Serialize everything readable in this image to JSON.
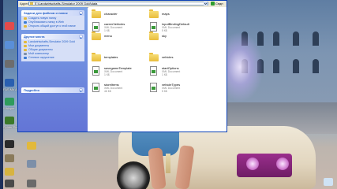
{
  "window": {
    "address_label": "Адрес",
    "address_value": "E:\\Landwirtschafts-Simulator 2009 Gold\\data",
    "go_label": "Седп"
  },
  "taskpane": {
    "panels": [
      {
        "title": "Задачи для файлов и папок",
        "expanded": true,
        "items": [
          {
            "label": "Создать новую папку",
            "icon": "new-folder-icon",
            "color": "#e2b93b"
          },
          {
            "label": "Опубликовать папку в Web",
            "icon": "publish-web-icon",
            "color": "#3a7bd5"
          },
          {
            "label": "Открыть общий доступ к этой папке",
            "icon": "share-folder-icon",
            "color": "#e2b93b"
          }
        ]
      },
      {
        "title": "Другие места",
        "expanded": true,
        "items": [
          {
            "label": "Landwirtschafts-Simulator 2009 Gold",
            "icon": "folder-icon",
            "color": "#e2b93b"
          },
          {
            "label": "Мои документы",
            "icon": "my-documents-icon",
            "color": "#e2b93b"
          },
          {
            "label": "Общие документы",
            "icon": "shared-documents-icon",
            "color": "#e2b93b"
          },
          {
            "label": "Мой компьютер",
            "icon": "my-computer-icon",
            "color": "#7d8fa8"
          },
          {
            "label": "Сетевое окружение",
            "icon": "network-places-icon",
            "color": "#3a7bd5"
          }
        ]
      },
      {
        "title": "Подробно",
        "expanded": false,
        "items": []
      }
    ]
  },
  "files": [
    {
      "name": "character",
      "type": "folder"
    },
    {
      "name": "maps",
      "type": "folder"
    },
    {
      "name": "careerVehicles",
      "type": "xml",
      "kind": "XML Document",
      "size": "1 КБ"
    },
    {
      "name": "inputBindingDefault",
      "type": "xml",
      "kind": "XML Document",
      "size": "5 КБ"
    },
    {
      "name": "menu",
      "type": "folder"
    },
    {
      "name": "sky",
      "type": "folder"
    },
    {
      "name": "templates",
      "type": "folder"
    },
    {
      "name": "vehicles",
      "type": "folder"
    },
    {
      "name": "savegameTemplate",
      "type": "xml",
      "kind": "XML Document",
      "size": "1 КБ"
    },
    {
      "name": "startOptions",
      "type": "xml",
      "kind": "XML Document",
      "size": "1 КБ"
    },
    {
      "name": "storeItems",
      "type": "xml",
      "kind": "XML Document",
      "size": "46 КБ"
    },
    {
      "name": "vehicleTypes",
      "type": "xml",
      "kind": "XML Document",
      "size": "5 КБ"
    }
  ],
  "desktop": {
    "icons": [
      {
        "label": "",
        "color": "#e34b4b"
      },
      {
        "label": "",
        "color": "#5a8fd8"
      },
      {
        "label": "",
        "color": "#6d6d6d"
      },
      {
        "label": "FAS Mo Antiviru",
        "color": "#2a5fb0"
      },
      {
        "label": "Whisper",
        "color": "#2f9c5c"
      },
      {
        "label": "Spider Pla",
        "color": "#3b7a2a"
      }
    ]
  }
}
